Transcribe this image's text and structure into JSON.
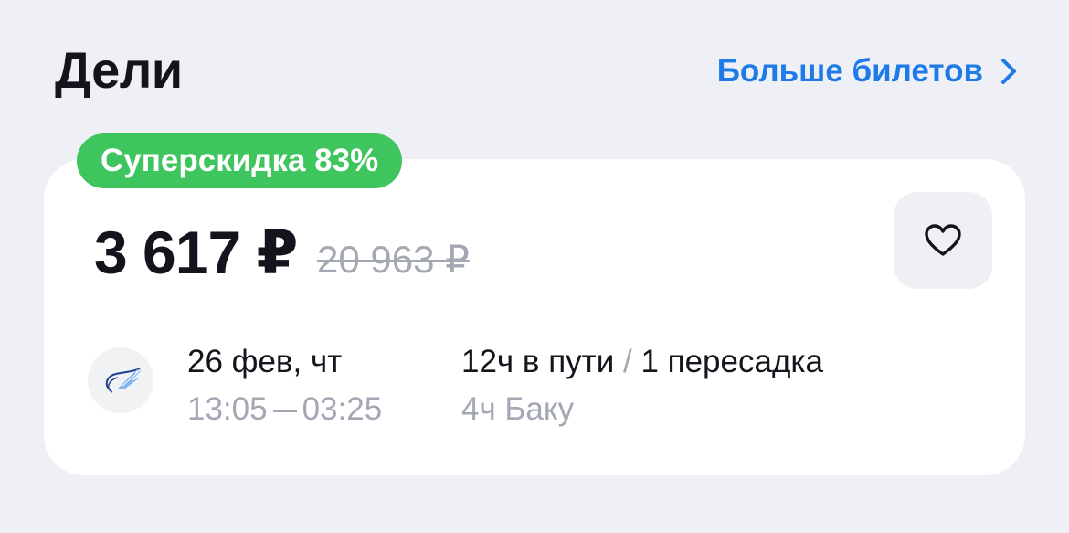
{
  "header": {
    "title": "Дели",
    "more_link": "Больше билетов"
  },
  "ticket": {
    "badge": "Суперскидка 83%",
    "price": "3 617 ₽",
    "old_price": "20 963 ₽",
    "date": "26 фев, чт",
    "departure": "13:05",
    "arrival": "03:25",
    "duration": "12ч в пути",
    "slash": "/",
    "transfers": "1 пересадка",
    "stopover": "4ч Баку"
  },
  "colors": {
    "accent": "#1e7ae6",
    "badge": "#3ec55e",
    "muted": "#a3a8b3",
    "background": "#eff0f5"
  },
  "icons": {
    "more": "chevron-right-icon",
    "favorite": "heart-icon",
    "airline": "airline-logo"
  }
}
